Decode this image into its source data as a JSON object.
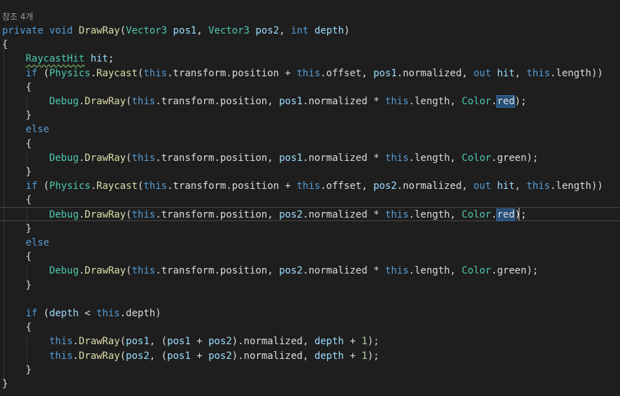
{
  "codelens": "참조 4개",
  "colors": {
    "background": "#1e1e1e",
    "keyword": "#569cd6",
    "type": "#4ec9b0",
    "function": "#dcdcaa",
    "parameter": "#9cdcfe",
    "text": "#dcdcdc",
    "number": "#b5cea8",
    "selection": "#264f78"
  },
  "lines": [
    [
      [
        "kw",
        "private"
      ],
      [
        "p",
        " "
      ],
      [
        "kw",
        "void"
      ],
      [
        "p",
        " "
      ],
      [
        "fn",
        "DrawRay"
      ],
      [
        "p",
        "("
      ],
      [
        "ty",
        "Vector3"
      ],
      [
        "p",
        " "
      ],
      [
        "pa",
        "pos1"
      ],
      [
        "p",
        ", "
      ],
      [
        "ty",
        "Vector3"
      ],
      [
        "p",
        " "
      ],
      [
        "pa",
        "pos2"
      ],
      [
        "p",
        ", "
      ],
      [
        "kw",
        "int"
      ],
      [
        "p",
        " "
      ],
      [
        "pa",
        "depth"
      ],
      [
        "p",
        ")"
      ]
    ],
    [
      [
        "p",
        "{"
      ]
    ],
    [
      [
        "p",
        "    "
      ],
      [
        "tysq",
        "RaycastHit"
      ],
      [
        "p",
        " "
      ],
      [
        "pa",
        "hit"
      ],
      [
        "p",
        ";"
      ]
    ],
    [
      [
        "p",
        "    "
      ],
      [
        "kw",
        "if"
      ],
      [
        "p",
        " ("
      ],
      [
        "ty",
        "Physics"
      ],
      [
        "p",
        "."
      ],
      [
        "fn",
        "Raycast"
      ],
      [
        "p",
        "("
      ],
      [
        "kw",
        "this"
      ],
      [
        "p",
        ".transform.position + "
      ],
      [
        "kw",
        "this"
      ],
      [
        "p",
        ".offset, "
      ],
      [
        "pa",
        "pos1"
      ],
      [
        "p",
        ".normalized, "
      ],
      [
        "kw",
        "out"
      ],
      [
        "p",
        " "
      ],
      [
        "pa",
        "hit"
      ],
      [
        "p",
        ", "
      ],
      [
        "kw",
        "this"
      ],
      [
        "p",
        ".length))"
      ]
    ],
    [
      [
        "p",
        "    {"
      ]
    ],
    [
      [
        "p",
        "        "
      ],
      [
        "ty",
        "Debug"
      ],
      [
        "p",
        "."
      ],
      [
        "fn",
        "DrawRay"
      ],
      [
        "p",
        "("
      ],
      [
        "kw",
        "this"
      ],
      [
        "p",
        ".transform.position, "
      ],
      [
        "pa",
        "pos1"
      ],
      [
        "p",
        ".normalized * "
      ],
      [
        "kw",
        "this"
      ],
      [
        "p",
        ".length, "
      ],
      [
        "ty",
        "Color"
      ],
      [
        "p",
        "."
      ],
      [
        "hl",
        "red"
      ],
      [
        "p",
        ");"
      ]
    ],
    [
      [
        "p",
        "    }"
      ]
    ],
    [
      [
        "p",
        "    "
      ],
      [
        "kw",
        "else"
      ]
    ],
    [
      [
        "p",
        "    {"
      ]
    ],
    [
      [
        "p",
        "        "
      ],
      [
        "ty",
        "Debug"
      ],
      [
        "p",
        "."
      ],
      [
        "fn",
        "DrawRay"
      ],
      [
        "p",
        "("
      ],
      [
        "kw",
        "this"
      ],
      [
        "p",
        ".transform.position, "
      ],
      [
        "pa",
        "pos1"
      ],
      [
        "p",
        ".normalized * "
      ],
      [
        "kw",
        "this"
      ],
      [
        "p",
        ".length, "
      ],
      [
        "ty",
        "Color"
      ],
      [
        "p",
        ".green);"
      ]
    ],
    [
      [
        "p",
        "    }"
      ]
    ],
    [
      [
        "p",
        "    "
      ],
      [
        "kw",
        "if"
      ],
      [
        "p",
        " ("
      ],
      [
        "ty",
        "Physics"
      ],
      [
        "p",
        "."
      ],
      [
        "fn",
        "Raycast"
      ],
      [
        "p",
        "("
      ],
      [
        "kw",
        "this"
      ],
      [
        "p",
        ".transform.position + "
      ],
      [
        "kw",
        "this"
      ],
      [
        "p",
        ".offset, "
      ],
      [
        "pa",
        "pos2"
      ],
      [
        "p",
        ".normalized, "
      ],
      [
        "kw",
        "out"
      ],
      [
        "p",
        " "
      ],
      [
        "pa",
        "hit"
      ],
      [
        "p",
        ", "
      ],
      [
        "kw",
        "this"
      ],
      [
        "p",
        ".length))"
      ]
    ],
    [
      [
        "p",
        "    {"
      ]
    ],
    [
      [
        "p",
        "        "
      ],
      [
        "ty",
        "Debug"
      ],
      [
        "p",
        "."
      ],
      [
        "fn",
        "DrawRay"
      ],
      [
        "p",
        "("
      ],
      [
        "kw",
        "this"
      ],
      [
        "p",
        ".transform.position, "
      ],
      [
        "pa",
        "pos2"
      ],
      [
        "p",
        ".normalized * "
      ],
      [
        "kw",
        "this"
      ],
      [
        "p",
        ".length, "
      ],
      [
        "ty",
        "Color"
      ],
      [
        "p",
        "."
      ],
      [
        "hl",
        "red"
      ],
      [
        "p",
        ");"
      ]
    ],
    [
      [
        "p",
        "    }"
      ]
    ],
    [
      [
        "p",
        "    "
      ],
      [
        "kw",
        "else"
      ]
    ],
    [
      [
        "p",
        "    {"
      ]
    ],
    [
      [
        "p",
        "        "
      ],
      [
        "ty",
        "Debug"
      ],
      [
        "p",
        "."
      ],
      [
        "fn",
        "DrawRay"
      ],
      [
        "p",
        "("
      ],
      [
        "kw",
        "this"
      ],
      [
        "p",
        ".transform.position, "
      ],
      [
        "pa",
        "pos2"
      ],
      [
        "p",
        ".normalized * "
      ],
      [
        "kw",
        "this"
      ],
      [
        "p",
        ".length, "
      ],
      [
        "ty",
        "Color"
      ],
      [
        "p",
        ".green);"
      ]
    ],
    [
      [
        "p",
        "    }"
      ]
    ],
    [
      [
        "p",
        ""
      ]
    ],
    [
      [
        "p",
        "    "
      ],
      [
        "kw",
        "if"
      ],
      [
        "p",
        " ("
      ],
      [
        "pa",
        "depth"
      ],
      [
        "p",
        " < "
      ],
      [
        "kw",
        "this"
      ],
      [
        "p",
        ".depth)"
      ]
    ],
    [
      [
        "p",
        "    {"
      ]
    ],
    [
      [
        "p",
        "        "
      ],
      [
        "kw",
        "this"
      ],
      [
        "p",
        "."
      ],
      [
        "fn",
        "DrawRay"
      ],
      [
        "p",
        "("
      ],
      [
        "pa",
        "pos1"
      ],
      [
        "p",
        ", ("
      ],
      [
        "pa",
        "pos1"
      ],
      [
        "p",
        " + "
      ],
      [
        "pa",
        "pos2"
      ],
      [
        "p",
        ").normalized, "
      ],
      [
        "pa",
        "depth"
      ],
      [
        "p",
        " + "
      ],
      [
        "nu",
        "1"
      ],
      [
        "p",
        ");"
      ]
    ],
    [
      [
        "p",
        "        "
      ],
      [
        "kw",
        "this"
      ],
      [
        "p",
        "."
      ],
      [
        "fn",
        "DrawRay"
      ],
      [
        "p",
        "("
      ],
      [
        "pa",
        "pos2"
      ],
      [
        "p",
        ", ("
      ],
      [
        "pa",
        "pos1"
      ],
      [
        "p",
        " + "
      ],
      [
        "pa",
        "pos2"
      ],
      [
        "p",
        ").normalized, "
      ],
      [
        "pa",
        "depth"
      ],
      [
        "p",
        " + "
      ],
      [
        "nu",
        "1"
      ],
      [
        "p",
        ");"
      ]
    ],
    [
      [
        "p",
        "    }"
      ]
    ],
    [
      [
        "p",
        "}"
      ]
    ]
  ]
}
